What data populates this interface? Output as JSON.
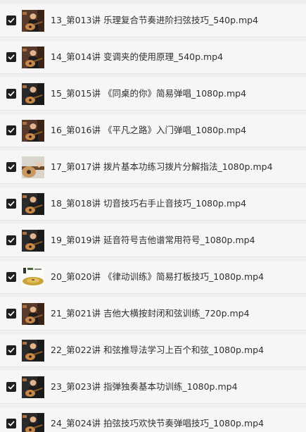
{
  "files": [
    {
      "name": "13_第013讲 乐理复合节奏进阶扫弦技巧_540p.mp4",
      "selected": true,
      "thumb": "guitar-man"
    },
    {
      "name": "14_第014讲 变调夹的使用原理_540p.mp4",
      "selected": true,
      "thumb": "guitar-man"
    },
    {
      "name": "15_第015讲 《同桌的你》简易弹唱_1080p.mp4",
      "selected": true,
      "thumb": "guitar-man-dark"
    },
    {
      "name": "16_第016讲 《平凡之路》入门弹唱_1080p.mp4",
      "selected": true,
      "thumb": "guitar-man"
    },
    {
      "name": "17_第017讲 拨片基本功练习拨片分解指法_1080p.mp4",
      "selected": true,
      "thumb": "guitar-closeup"
    },
    {
      "name": "18_第018讲 切音技巧右手止音技巧_1080p.mp4",
      "selected": true,
      "thumb": "guitar-man-dark"
    },
    {
      "name": "19_第019讲 延音符号吉他谱常用符号_1080p.mp4",
      "selected": true,
      "thumb": "guitar-man-dark"
    },
    {
      "name": "20_第020讲 《律动训练》简易打板技巧_1080p.mp4",
      "selected": true,
      "thumb": "cymbal"
    },
    {
      "name": "21_第021讲 吉他大横按封闭和弦训练_720p.mp4",
      "selected": true,
      "thumb": "guitar-man"
    },
    {
      "name": "22_第022讲 和弦推导法学习上百个和弦_1080p.mp4",
      "selected": true,
      "thumb": "guitar-man-dark"
    },
    {
      "name": "23_第023讲 指弹独奏基本功训练_1080p.mp4",
      "selected": true,
      "thumb": "guitar-man-dark"
    },
    {
      "name": "24_第024讲 拍弦技巧欢快节奏弹唱技巧_1080p.mp4",
      "selected": true,
      "thumb": "guitar-man-dark"
    }
  ]
}
